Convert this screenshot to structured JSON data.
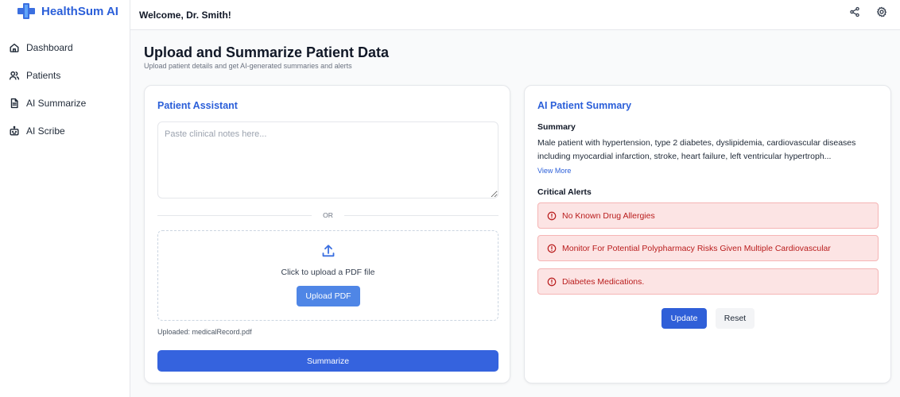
{
  "app": {
    "name": "HealthSum AI"
  },
  "sidebar": {
    "items": [
      {
        "label": "Dashboard",
        "icon": "home-icon"
      },
      {
        "label": "Patients",
        "icon": "users-icon"
      },
      {
        "label": "AI Summarize",
        "icon": "document-icon"
      },
      {
        "label": "AI Scribe",
        "icon": "robot-icon"
      }
    ]
  },
  "header": {
    "welcome": "Welcome, Dr. Smith!",
    "icons": [
      "share-icon",
      "settings-icon"
    ]
  },
  "page": {
    "title": "Upload and Summarize Patient Data",
    "subtitle": "Upload patient details and get AI-generated summaries and alerts"
  },
  "assistant": {
    "title": "Patient Assistant",
    "notes_placeholder": "Paste clinical notes here...",
    "notes_value": "",
    "divider": "OR",
    "dropzone_text": "Click to upload a PDF file",
    "upload_button": "Upload PDF",
    "uploaded_text": "Uploaded: medicalRecord.pdf",
    "summarize_button": "Summarize"
  },
  "summary_panel": {
    "title": "AI Patient Summary",
    "summary_label": "Summary",
    "summary_text": "Male patient with hypertension, type 2 diabetes, dyslipidemia, cardiovascular diseases including myocardial infarction, stroke, heart failure, left ventricular hypertroph...",
    "view_more": "View More",
    "alerts_label": "Critical Alerts",
    "alerts": [
      "No Known Drug Allergies",
      "Monitor For Potential Polypharmacy Risks Given Multiple Cardiovascular",
      "Diabetes Medications."
    ],
    "update_button": "Update",
    "reset_button": "Reset"
  },
  "colors": {
    "brand": "#2b5fd9",
    "primary_button": "#3563de",
    "alert_bg": "#fce4e4",
    "alert_text": "#b91c1c"
  }
}
